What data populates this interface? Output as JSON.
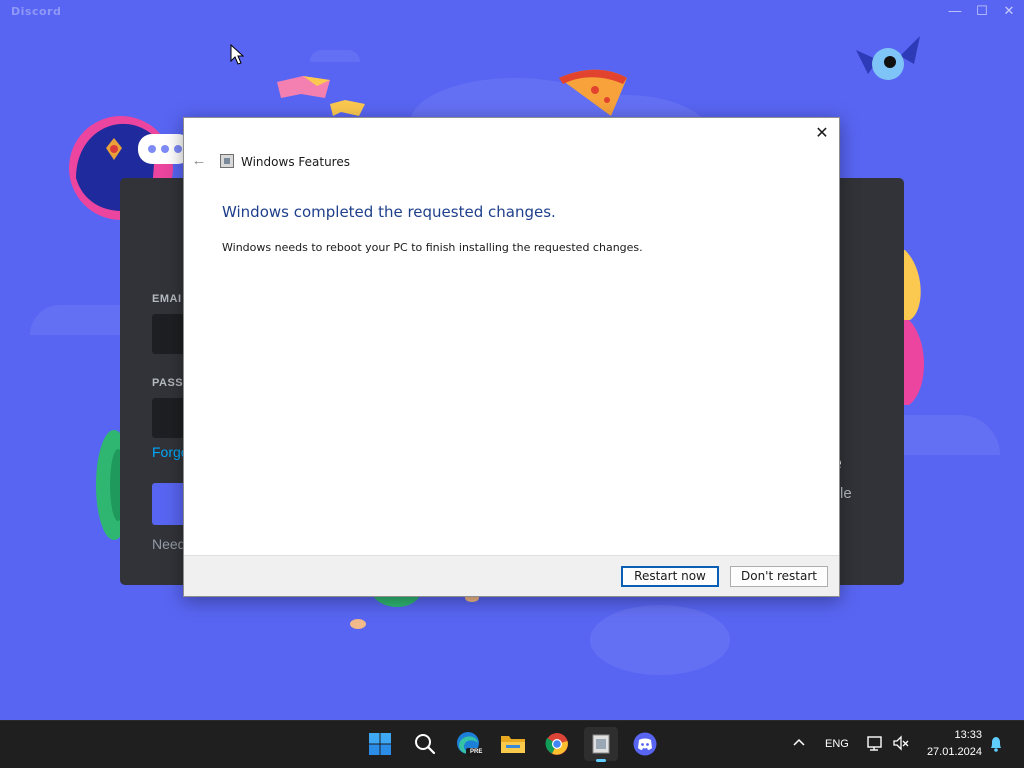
{
  "discord": {
    "brand": "Discord",
    "login": {
      "email_label": "EMAI",
      "password_label": "PASS",
      "forgot_text": "Forgo",
      "need_text": "Need",
      "qr_title": "de",
      "qr_subtitle": "obile"
    },
    "window_controls": {
      "minimize": "—",
      "maximize": "☐",
      "close": "✕"
    }
  },
  "dialog": {
    "title": "Windows Features",
    "heading": "Windows completed the requested changes.",
    "message": "Windows needs to reboot your PC to finish installing the requested changes.",
    "back_icon": "←",
    "close_icon": "✕",
    "buttons": {
      "primary": "Restart now",
      "secondary": "Don't restart"
    }
  },
  "taskbar": {
    "apps": [
      {
        "name": "start",
        "icon": "windows-logo-icon"
      },
      {
        "name": "search",
        "icon": "search-icon"
      },
      {
        "name": "edge",
        "icon": "edge-dev-icon"
      },
      {
        "name": "file-explorer",
        "icon": "folder-icon"
      },
      {
        "name": "chrome",
        "icon": "chrome-icon"
      },
      {
        "name": "windows-features",
        "icon": "windows-features-icon",
        "active": true
      },
      {
        "name": "discord",
        "icon": "discord-icon"
      }
    ],
    "edge_badge": "PRE",
    "tray": {
      "language": "ENG",
      "time": "13:33",
      "date": "27.01.2024"
    }
  },
  "colors": {
    "discord_blurple": "#5865f2",
    "dialog_heading": "#1e3f8c",
    "primary_button_border": "#0a5fb4",
    "taskbar_bg": "#1f1f1f",
    "active_indicator": "#60cdff"
  }
}
